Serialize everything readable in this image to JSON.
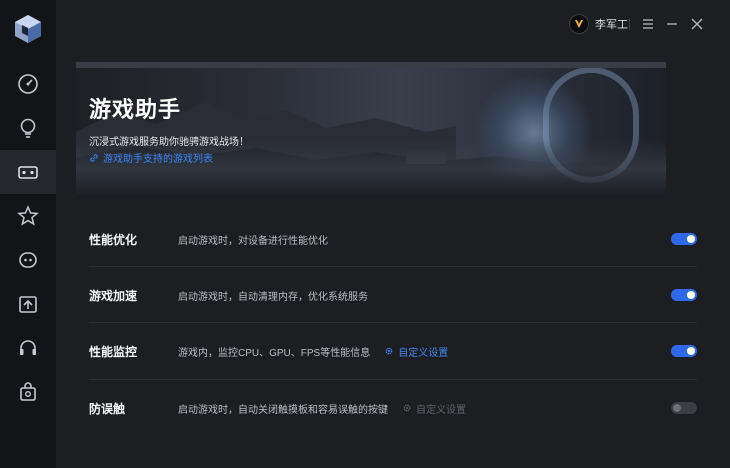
{
  "colors": {
    "accent": "#2f6be8",
    "link": "#3f86f5",
    "sidebar_bg": "#131417",
    "main_bg": "#1d1e22"
  },
  "sidebar": {
    "items": [
      {
        "name": "dashboard",
        "icon": "speedometer-icon"
      },
      {
        "name": "cleanup",
        "icon": "lightbulb-icon"
      },
      {
        "name": "game",
        "icon": "gamepad-icon",
        "active": true
      },
      {
        "name": "favorites",
        "icon": "star-icon"
      },
      {
        "name": "assistant",
        "icon": "chat-bot-icon"
      },
      {
        "name": "upload",
        "icon": "upload-icon"
      },
      {
        "name": "headset",
        "icon": "headset-icon"
      },
      {
        "name": "store",
        "icon": "shopping-bag-icon"
      }
    ]
  },
  "titlebar": {
    "username": "李军工"
  },
  "banner": {
    "title": "游戏助手",
    "subtitle": "沉浸式游戏服务助你驰骋游戏战场！",
    "link": "游戏助手支持的游戏列表"
  },
  "settings": [
    {
      "title": "性能优化",
      "desc": "启动游戏时，对设备进行性能优化",
      "custom": "",
      "enabled": true
    },
    {
      "title": "游戏加速",
      "desc": "启动游戏时，自动清理内存，优化系统服务",
      "custom": "",
      "enabled": true
    },
    {
      "title": "性能监控",
      "desc": "游戏内，监控CPU、GPU、FPS等性能信息",
      "custom": "自定义设置",
      "enabled": true
    },
    {
      "title": "防误触",
      "desc": "启动游戏时，自动关闭触摸板和容易误触的按键",
      "custom": "自定义设置",
      "enabled": false
    }
  ]
}
